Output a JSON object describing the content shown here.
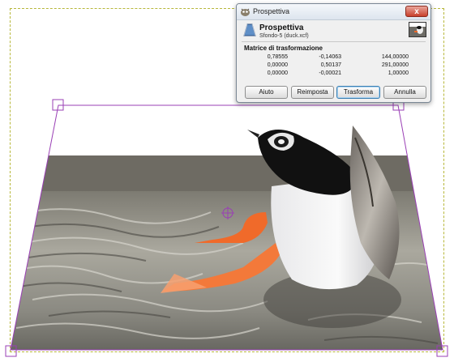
{
  "dialog": {
    "window_title": "Prospettiva",
    "header_title": "Prospettiva",
    "header_subtitle": "Sfondo-5 (duck.xcf)",
    "close_label": "x",
    "matrix_label": "Matrice di trasformazione",
    "matrix": [
      [
        "0,78555",
        "-0,14063",
        "144,00000"
      ],
      [
        "0,00000",
        "0,50137",
        "291,00000"
      ],
      [
        "0,00000",
        "-0,00021",
        "1,00000"
      ]
    ],
    "buttons": {
      "help": "Aiuto",
      "reset": "Reimposta",
      "transform": "Trasforma",
      "cancel": "Annulla"
    }
  },
  "icons": {
    "app": "gimp-icon",
    "tool": "perspective-tool-icon",
    "close": "close-icon"
  },
  "colors": {
    "frame": "#9a3fb5",
    "layer_boundary": "#b7b73a",
    "duck_leg": "#f06a2a"
  }
}
